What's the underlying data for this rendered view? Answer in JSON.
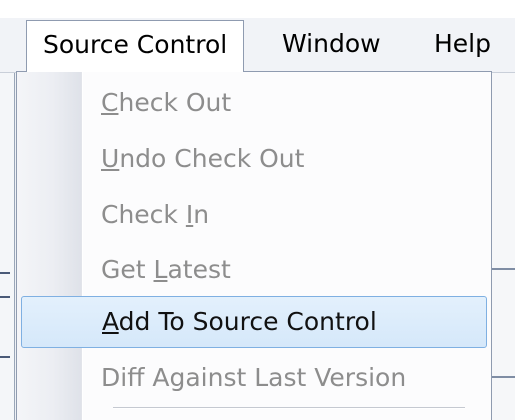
{
  "menubar": {
    "items": [
      {
        "label": "Source Control",
        "active": true
      },
      {
        "label": "Window",
        "active": false
      },
      {
        "label": "Help",
        "active": false
      }
    ]
  },
  "dropdown": {
    "items": [
      {
        "pre": "",
        "key": "C",
        "post": "heck Out",
        "enabled": false,
        "highlighted": false
      },
      {
        "pre": "",
        "key": "U",
        "post": "ndo Check Out",
        "enabled": false,
        "highlighted": false
      },
      {
        "pre": "Check ",
        "key": "I",
        "post": "n",
        "enabled": false,
        "highlighted": false
      },
      {
        "pre": "Get ",
        "key": "L",
        "post": "atest",
        "enabled": false,
        "highlighted": false
      },
      {
        "pre": "",
        "key": "A",
        "post": "dd To Source Control",
        "enabled": true,
        "highlighted": true
      },
      {
        "pre": "Diff Against Last Version",
        "key": "",
        "post": "",
        "enabled": false,
        "highlighted": false
      }
    ]
  },
  "colors": {
    "highlight_border": "#7fb0e2",
    "highlight_fill": "#dbecfb",
    "disabled_text": "#8d8d8d"
  }
}
